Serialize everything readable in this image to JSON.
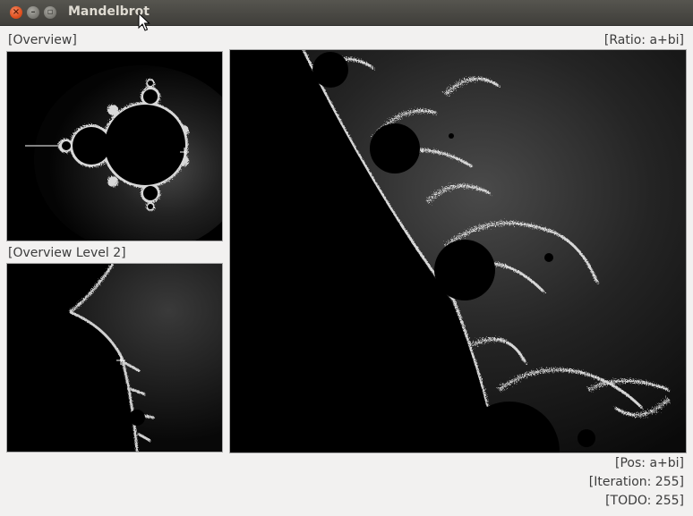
{
  "window": {
    "title": "Mandelbrot"
  },
  "labels": {
    "overview": "[Overview]",
    "overview_level2": "[Overview Level 2]",
    "ratio": "[Ratio: a+bi]"
  },
  "status": {
    "pos": "[Pos: a+bi]",
    "iteration": "[Iteration: 255]",
    "todo": "[TODO: 255]"
  },
  "icons": {
    "close": "close-icon",
    "minimize": "minimize-icon",
    "maximize": "maximize-icon"
  }
}
